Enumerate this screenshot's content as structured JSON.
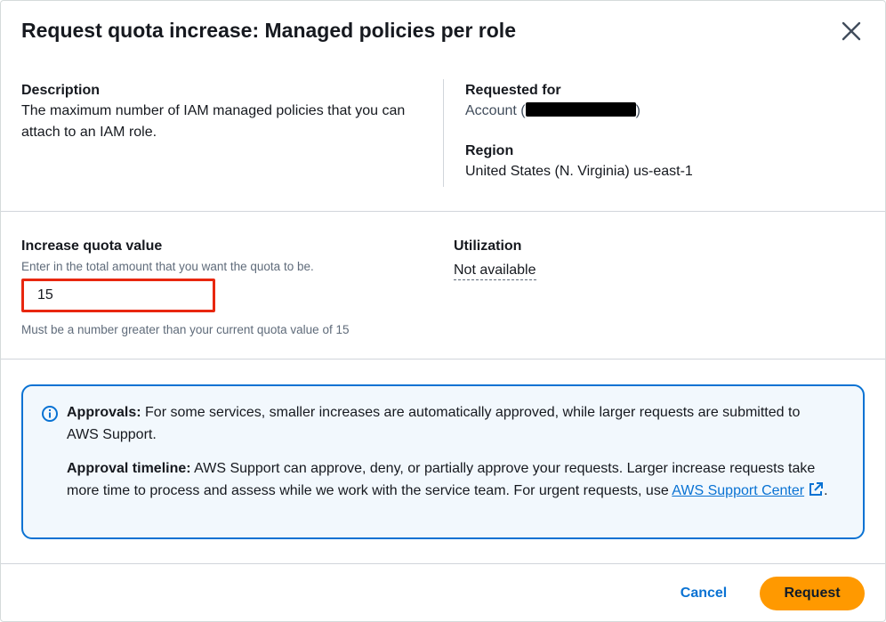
{
  "modal": {
    "title": "Request quota increase: Managed policies per role"
  },
  "details": {
    "description_label": "Description",
    "description_text": "The maximum number of IAM managed policies that you can attach to an IAM role.",
    "requested_for_label": "Requested for",
    "account_prefix": "Account (",
    "account_suffix": ")",
    "region_label": "Region",
    "region_value": "United States (N. Virginia) us-east-1"
  },
  "quota": {
    "label": "Increase quota value",
    "hint": "Enter in the total amount that you want the quota to be.",
    "value": "15",
    "constraint": "Must be a number greater than your current quota value of 15"
  },
  "utilization": {
    "label": "Utilization",
    "value": "Not available"
  },
  "alert": {
    "icon": "info-icon",
    "approvals_label": "Approvals:",
    "approvals_text": " For some services, smaller increases are automatically approved, while larger requests are submitted to AWS Support.",
    "timeline_label": "Approval timeline:",
    "timeline_text": " AWS Support can approve, deny, or partially approve your requests. Larger increase requests take more time to process and assess while we work with the service team. For urgent requests, use ",
    "link_label": "AWS Support Center",
    "link_icon": "external-link-icon",
    "link_suffix": "."
  },
  "footer": {
    "cancel_label": "Cancel",
    "request_label": "Request"
  },
  "colors": {
    "link_blue": "#0972d3",
    "primary_orange": "#ff9900",
    "alert_bg": "#f2f8fd",
    "highlight_red": "#e8270f"
  }
}
